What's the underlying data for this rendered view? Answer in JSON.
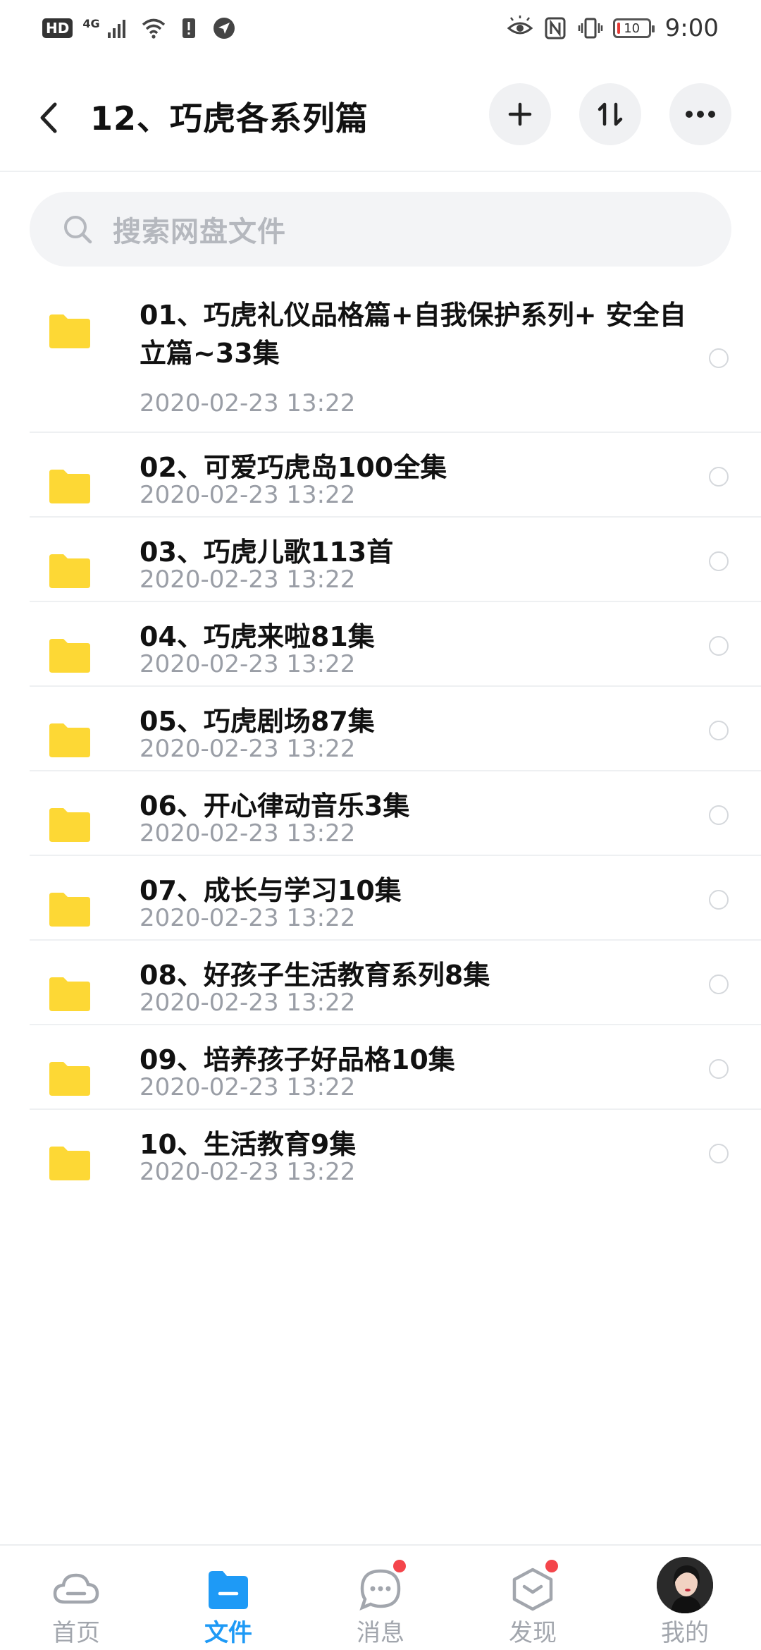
{
  "status_bar": {
    "hd": "HD",
    "network": "4G",
    "battery_level": "10",
    "time": "9:00"
  },
  "header": {
    "title": "12、巧虎各系列篇"
  },
  "search": {
    "placeholder": "搜索网盘文件"
  },
  "files": [
    {
      "name": "01、巧虎礼仪品格篇+自我保护系列+ 安全自立篇~33集",
      "date": "2020-02-23  13:22"
    },
    {
      "name": "02、可爱巧虎岛100全集",
      "date": "2020-02-23  13:22"
    },
    {
      "name": "03、巧虎儿歌113首",
      "date": "2020-02-23  13:22"
    },
    {
      "name": "04、巧虎来啦81集",
      "date": "2020-02-23  13:22"
    },
    {
      "name": "05、巧虎剧场87集",
      "date": "2020-02-23  13:22"
    },
    {
      "name": "06、开心律动音乐3集",
      "date": "2020-02-23  13:22"
    },
    {
      "name": "07、成长与学习10集",
      "date": "2020-02-23  13:22"
    },
    {
      "name": "08、好孩子生活教育系列8集",
      "date": "2020-02-23  13:22"
    },
    {
      "name": "09、培养孩子好品格10集",
      "date": "2020-02-23  13:22"
    },
    {
      "name": "10、生活教育9集",
      "date": "2020-02-23  13:22"
    }
  ],
  "bottom_nav": [
    {
      "label": "首页",
      "icon": "cloud-icon",
      "active": false
    },
    {
      "label": "文件",
      "icon": "folder-icon",
      "active": true
    },
    {
      "label": "消息",
      "icon": "message-icon",
      "active": false,
      "badge": true
    },
    {
      "label": "发现",
      "icon": "discover-icon",
      "active": false,
      "badge": true
    },
    {
      "label": "我的",
      "icon": "avatar",
      "active": false
    }
  ],
  "colors": {
    "accent": "#1e9af6",
    "folder": "#fdd835",
    "badge": "#f4454b"
  }
}
